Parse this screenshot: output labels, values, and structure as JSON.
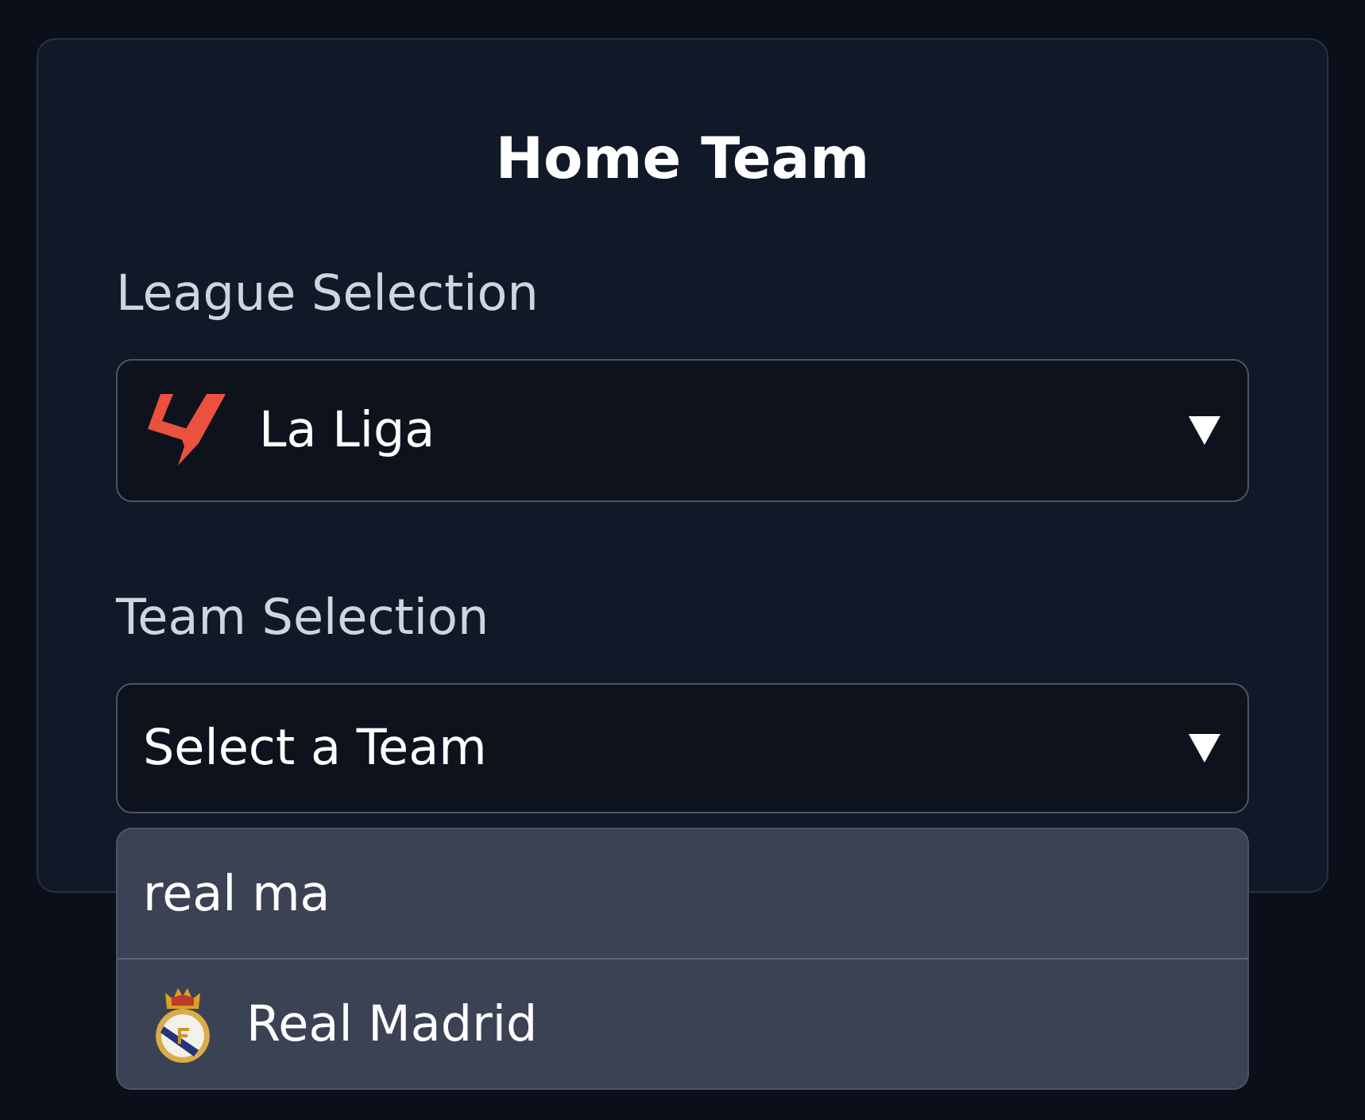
{
  "card": {
    "title": "Home Team"
  },
  "league_selection": {
    "label": "League Selection",
    "value": "La Liga",
    "expanded": false
  },
  "team_selection": {
    "label": "Team Selection",
    "placeholder": "Select a Team",
    "expanded": true,
    "search": {
      "value": "real ma"
    },
    "options": [
      {
        "label": "Real Madrid",
        "selected": false
      }
    ]
  }
}
